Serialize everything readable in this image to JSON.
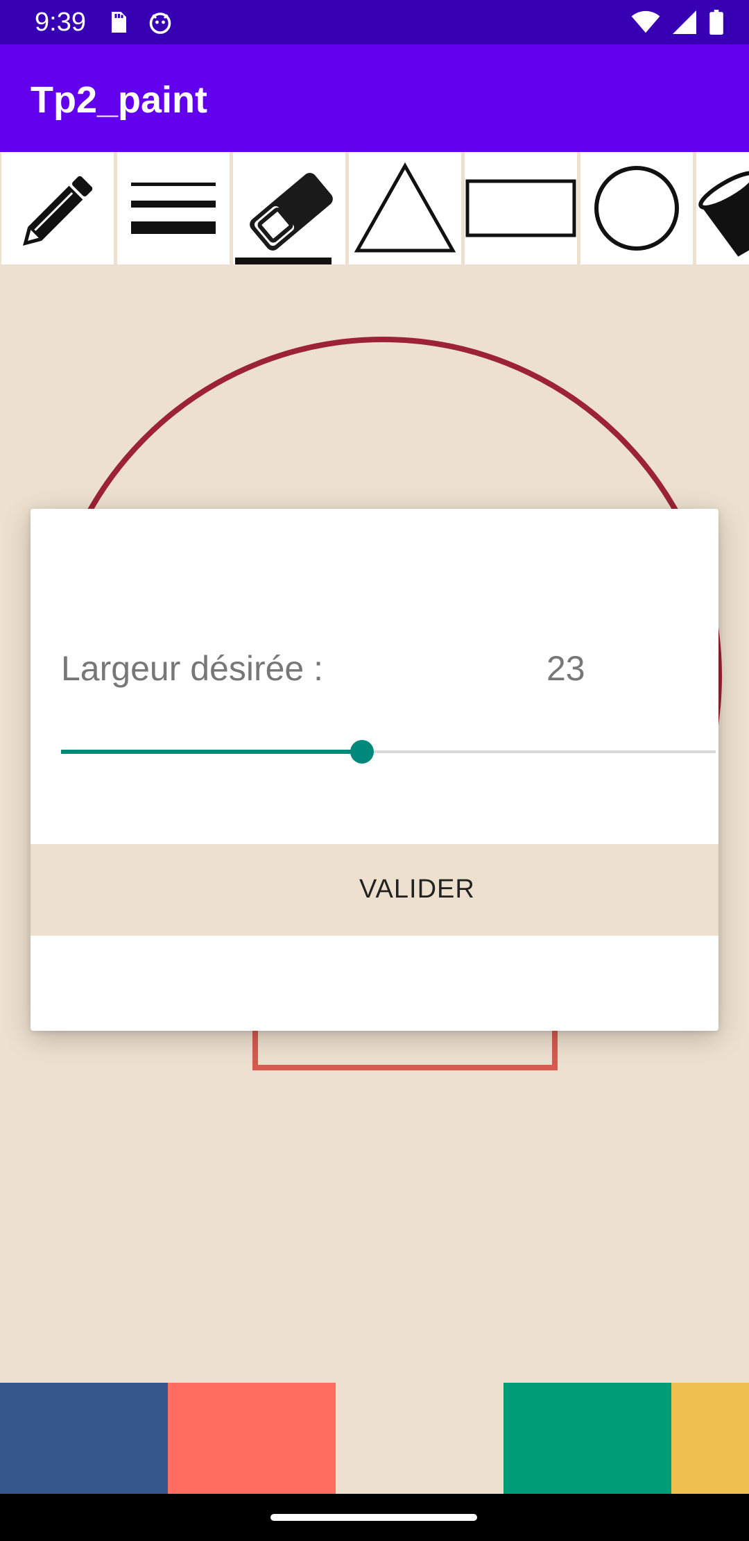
{
  "status_bar": {
    "time": "9:39",
    "left_icons": [
      "sd-card-icon",
      "android-debug-icon"
    ],
    "right_icons": [
      "wifi-icon",
      "cellular-signal-icon",
      "battery-icon"
    ]
  },
  "app_bar": {
    "title": "Tp2_paint"
  },
  "toolbar": {
    "tools": [
      {
        "name": "pencil",
        "icon": "pencil-icon",
        "selected": false
      },
      {
        "name": "line-thickness",
        "icon": "line-weight-icon",
        "selected": false
      },
      {
        "name": "eraser",
        "icon": "eraser-icon",
        "selected": true
      },
      {
        "name": "triangle",
        "icon": "triangle-icon",
        "selected": false
      },
      {
        "name": "rectangle",
        "icon": "rectangle-icon",
        "selected": false
      },
      {
        "name": "circle",
        "icon": "circle-icon",
        "selected": false
      },
      {
        "name": "paint-bucket",
        "icon": "paint-bucket-icon",
        "selected": false
      }
    ]
  },
  "canvas": {
    "background_color": "#ede0cf",
    "shapes": [
      {
        "type": "circle",
        "stroke": "#9b2335"
      },
      {
        "type": "rectangle",
        "stroke": "#d65a50"
      }
    ]
  },
  "dialog": {
    "label": "Largeur désirée :",
    "value": "23",
    "slider": {
      "min": 0,
      "max": 50,
      "value": 23,
      "fraction": 0.46,
      "color": "#00897b"
    },
    "validate_label": "VALIDER"
  },
  "palette": {
    "colors": [
      "#35578b",
      "#ff6f61",
      "#ede0cf",
      "#009b77",
      "#efc050"
    ]
  }
}
